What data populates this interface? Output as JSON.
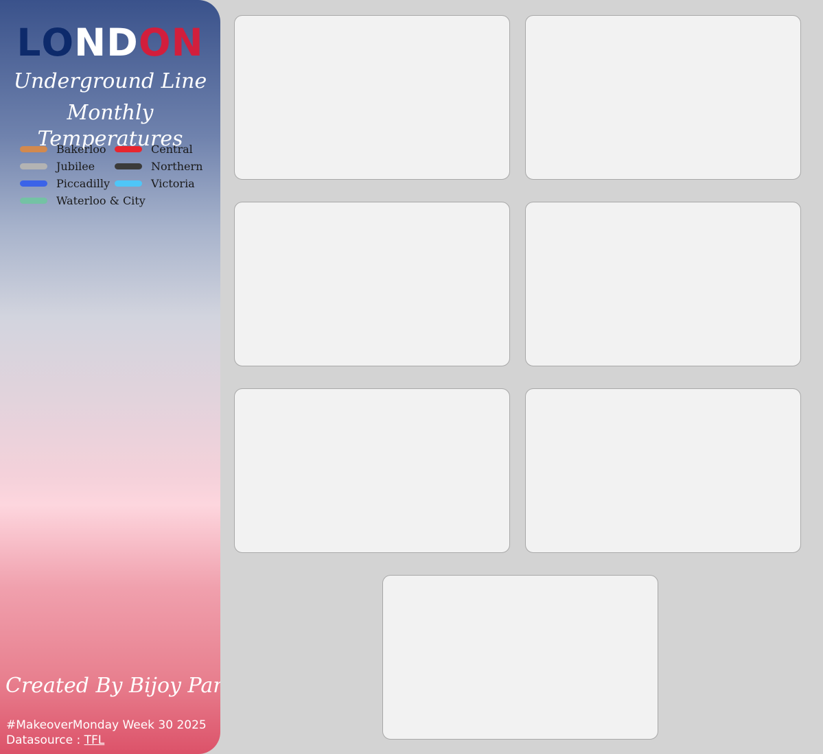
{
  "sidebar": {
    "logo": {
      "part1": "L",
      "part2": "O",
      "part3": "ND",
      "part4": "ON"
    },
    "subtitle_line1": "Underground Line",
    "subtitle_line2": "Monthly Temperatures",
    "legend": [
      {
        "label": "Bakerloo",
        "color": "#d2894e"
      },
      {
        "label": "Central",
        "color": "#e8262e"
      },
      {
        "label": "Jubilee",
        "color": "#b3b3b3"
      },
      {
        "label": "Northern",
        "color": "#3b3b3b"
      },
      {
        "label": "Piccadilly",
        "color": "#3b63e8"
      },
      {
        "label": "Victoria",
        "color": "#4fc6f7"
      },
      {
        "label": "Waterloo & City",
        "color": "#74c2a4"
      }
    ],
    "credit": "Created By  Bijoy Pantu",
    "footer_line1": "#MakeoverMonday Week 30 2025",
    "footer_prefix": "Datasource : ",
    "footer_link": "TFL"
  },
  "colors": {
    "logo_blue": "#0d2a6b",
    "logo_red": "#d21e3c",
    "panel_background": "#f2f2f2",
    "page_background": "#d3d3d3"
  }
}
